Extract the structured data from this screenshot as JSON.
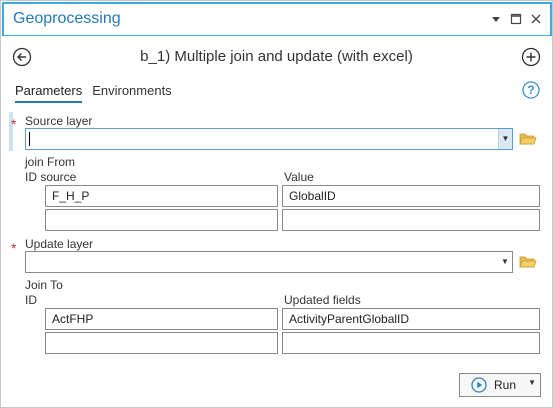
{
  "window": {
    "title": "Geoprocessing"
  },
  "header": {
    "tool_title": "b_1) Multiple join and update (with excel)"
  },
  "tabs": [
    {
      "label": "Parameters",
      "active": true
    },
    {
      "label": "Environments",
      "active": false
    }
  ],
  "source": {
    "label": "Source layer",
    "value": "",
    "join_from_label": "join From",
    "col1_header": "ID source",
    "col2_header": "Value",
    "rows": [
      {
        "col1": "F_H_P",
        "col2": "GlobalID"
      },
      {
        "col1": "",
        "col2": ""
      }
    ]
  },
  "update": {
    "label": "Update layer",
    "value": "",
    "join_to_label": "Join To",
    "col1_header": "ID",
    "col2_header": "Updated fields",
    "rows": [
      {
        "col1": "ActFHP",
        "col2": "ActivityParentGlobalID"
      },
      {
        "col1": "",
        "col2": ""
      }
    ]
  },
  "footer": {
    "run_label": "Run"
  },
  "icons": {
    "pin": "pin-icon",
    "maximize": "maximize-icon",
    "close": "close-icon",
    "back": "back-arrow-icon",
    "add": "add-plus-icon",
    "help": "help-icon",
    "folder": "folder-icon",
    "run": "play-icon"
  },
  "colors": {
    "accent": "#2679b8",
    "border_focus": "#3fa9e0",
    "required": "#c0392b",
    "folder": "#e8b84a"
  }
}
